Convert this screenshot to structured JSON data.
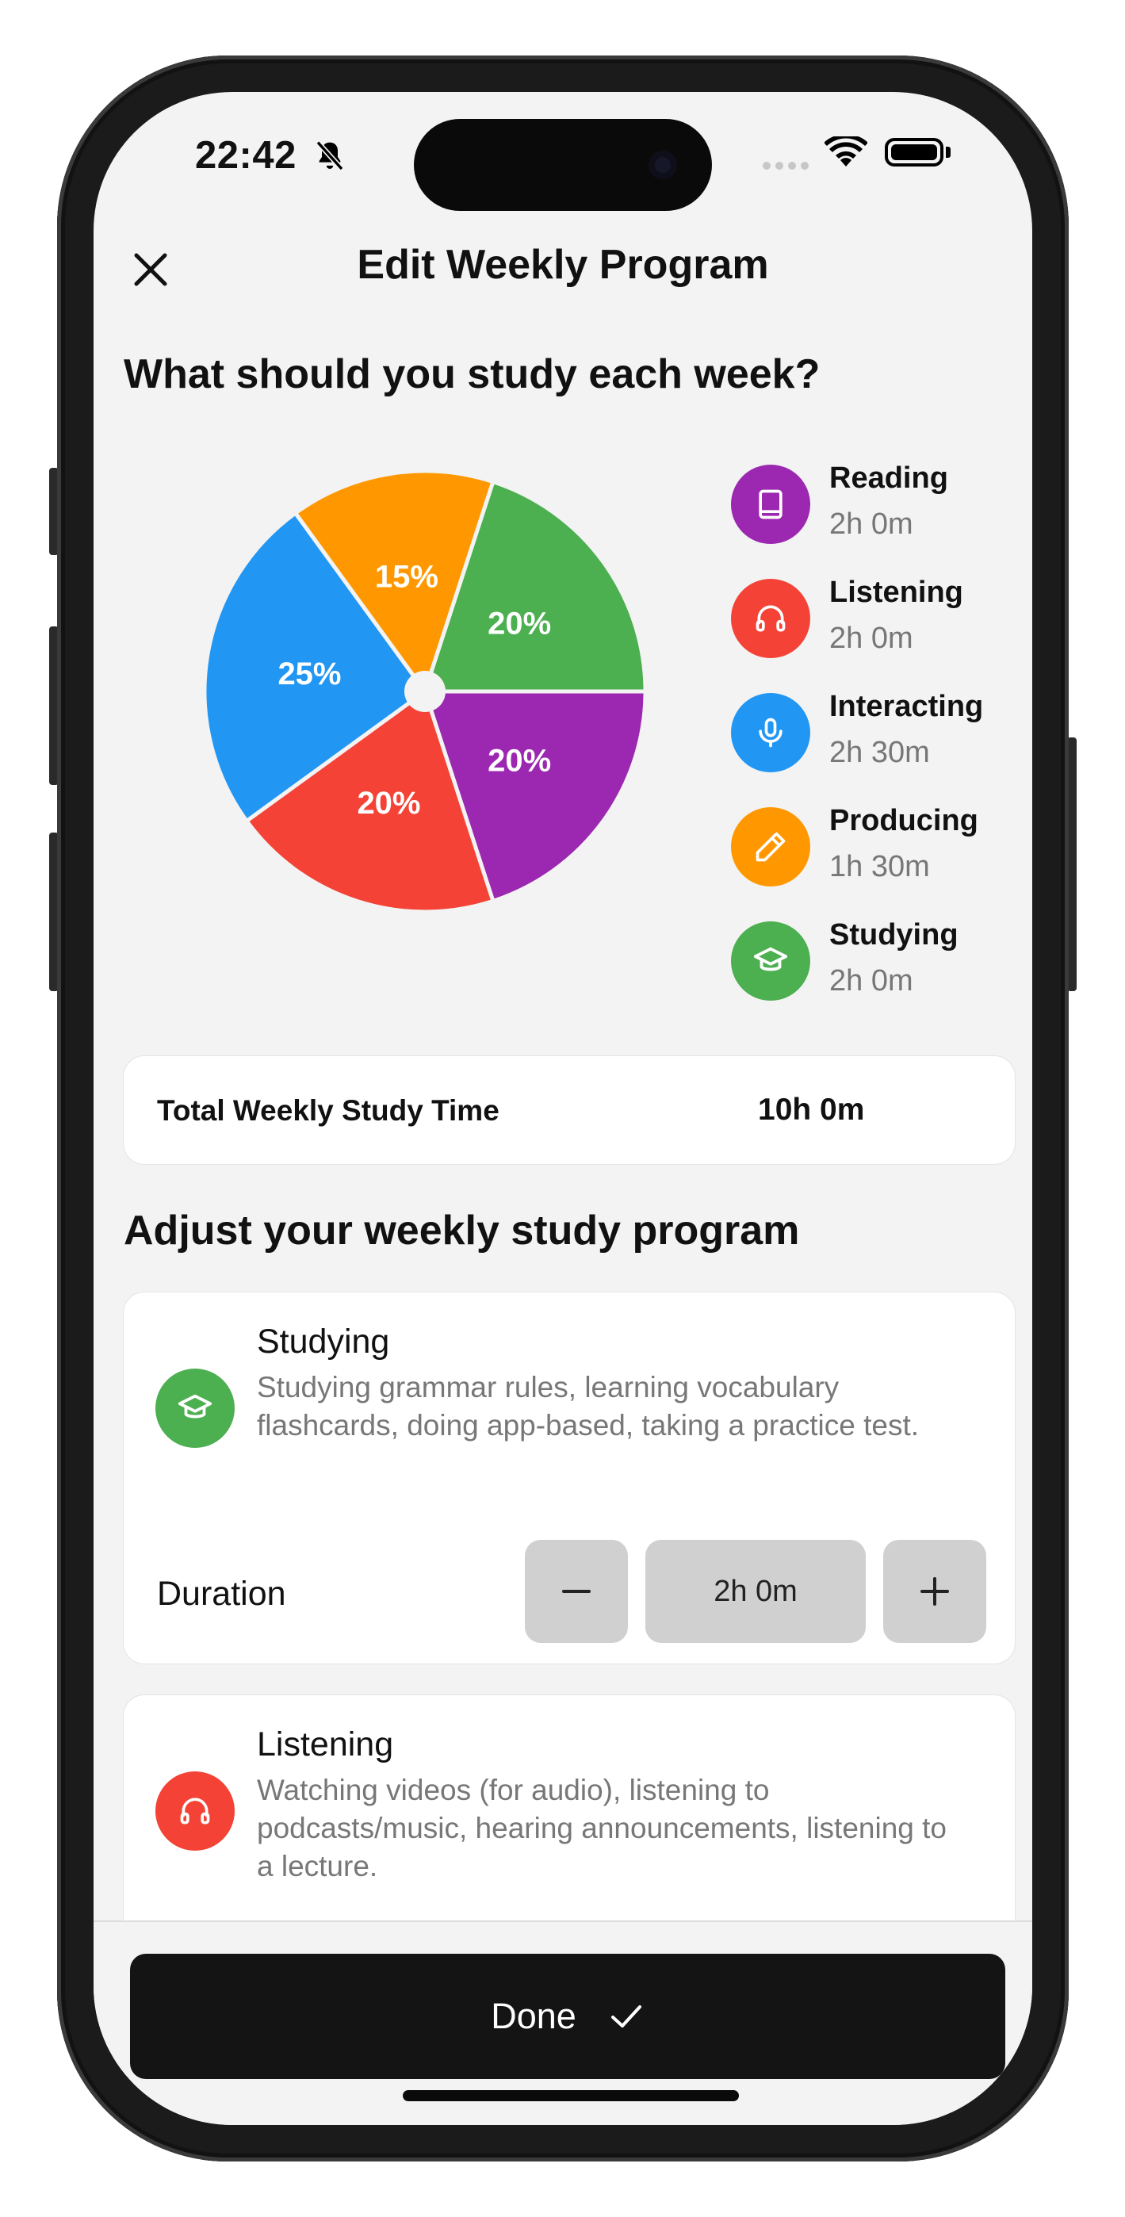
{
  "status": {
    "time": "22:42"
  },
  "header": {
    "title": "Edit Weekly Program"
  },
  "section1_title": "What should you study each week?",
  "chart_data": {
    "type": "pie",
    "slices": [
      {
        "label": "Reading",
        "value": 20,
        "color": "#9C27B0"
      },
      {
        "label": "Listening",
        "value": 20,
        "color": "#F44336"
      },
      {
        "label": "Interacting",
        "value": 25,
        "color": "#2196F3"
      },
      {
        "label": "Producing",
        "value": 15,
        "color": "#FF9800"
      },
      {
        "label": "Studying",
        "value": 20,
        "color": "#4CAF50"
      }
    ],
    "labels": [
      "20%",
      "20%",
      "25%",
      "15%",
      "20%"
    ]
  },
  "legend": [
    {
      "name": "Reading",
      "time": "2h 0m",
      "icon": "book-icon",
      "color": "#9C27B0"
    },
    {
      "name": "Listening",
      "time": "2h 0m",
      "icon": "headphones-icon",
      "color": "#F44336"
    },
    {
      "name": "Interacting",
      "time": "2h 30m",
      "icon": "microphone-icon",
      "color": "#2196F3"
    },
    {
      "name": "Producing",
      "time": "1h 30m",
      "icon": "pencil-icon",
      "color": "#FF9800"
    },
    {
      "name": "Studying",
      "time": "2h 0m",
      "icon": "graduation-cap-icon",
      "color": "#4CAF50"
    }
  ],
  "total": {
    "label": "Total Weekly Study Time",
    "value": "10h 0m"
  },
  "section2_title": "Adjust your weekly study program",
  "activities": [
    {
      "name": "Studying",
      "description": "Studying grammar rules, learning vocabulary flashcards, doing app-based, taking a practice test.",
      "icon": "graduation-cap-icon",
      "color": "#4CAF50",
      "duration_label": "Duration",
      "duration": "2h 0m"
    },
    {
      "name": "Listening",
      "description": "Watching videos (for audio), listening to podcasts/music, hearing announcements, listening to a lecture.",
      "icon": "headphones-icon",
      "color": "#F44336"
    }
  ],
  "done_button": {
    "label": "Done"
  }
}
